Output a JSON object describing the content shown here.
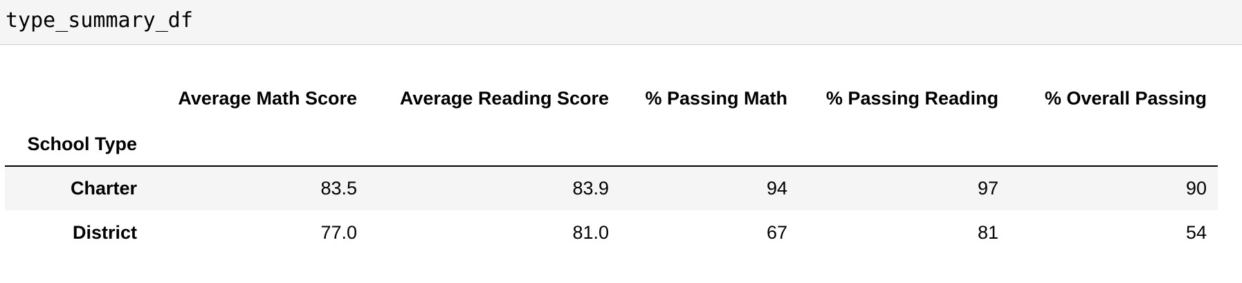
{
  "input": {
    "code": "type_summary_df"
  },
  "table": {
    "index_name": "School Type",
    "columns": [
      "Average Math Score",
      "Average Reading Score",
      "% Passing Math",
      "% Passing Reading",
      "% Overall Passing"
    ],
    "rows": [
      {
        "label": "Charter",
        "values": [
          "83.5",
          "83.9",
          "94",
          "97",
          "90"
        ]
      },
      {
        "label": "District",
        "values": [
          "77.0",
          "81.0",
          "67",
          "81",
          "54"
        ]
      }
    ]
  }
}
